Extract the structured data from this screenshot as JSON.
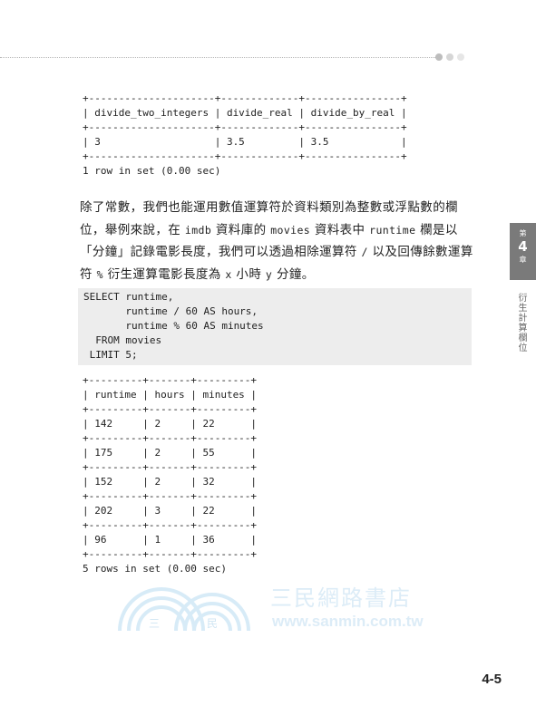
{
  "header": {
    "dot_colors": [
      "#bdbdbd",
      "#d6d6d6",
      "#e6e6e6"
    ]
  },
  "result1": {
    "border": "+---------------------+-------------+----------------+",
    "header": "| divide_two_integers | divide_real | divide_by_real |",
    "row": "| 3                   | 3.5         | 3.5            |",
    "footer": "1 row in set (0.00 sec)"
  },
  "paragraph": {
    "t1": "除了常數，我們也能運用數值運算符於資料類別為整數或浮點數的欄位，舉例來說，在 ",
    "c1": "imdb",
    "t2": " 資料庫的 ",
    "c2": "movies",
    "t3": " 資料表中 ",
    "c3": "runtime",
    "t4": " 欄是以「分鐘」記錄電影長度，我們可以透過相除運算符 ",
    "c4": "/",
    "t5": " 以及回傳餘數運算符 ",
    "c5": "%",
    "t6": " 衍生運算電影長度為 ",
    "c6": "x",
    "t7": " 小時 ",
    "c7": "y",
    "t8": " 分鐘。"
  },
  "code": {
    "lines": [
      "SELECT runtime,",
      "       runtime / 60 AS hours,",
      "       runtime % 60 AS minutes",
      "  FROM movies",
      " LIMIT 5;"
    ]
  },
  "result2": {
    "border": "+---------+-------+---------+",
    "header": "| runtime | hours | minutes |",
    "rows": [
      "| 142     | 2     | 22      |",
      "| 175     | 2     | 55      |",
      "| 152     | 2     | 32      |",
      "| 202     | 3     | 22      |",
      "| 96      | 1     | 36      |"
    ],
    "footer": "5 rows in set (0.00 sec)"
  },
  "side_tab": {
    "top": "第",
    "number": "4",
    "bottom": "章",
    "title": "衍生計算欄位"
  },
  "watermark": {
    "chinese": "三民網路書店",
    "url": "www.sanmin.com.tw",
    "logo_left": "三",
    "logo_right": "民"
  },
  "page_number": "4-5"
}
